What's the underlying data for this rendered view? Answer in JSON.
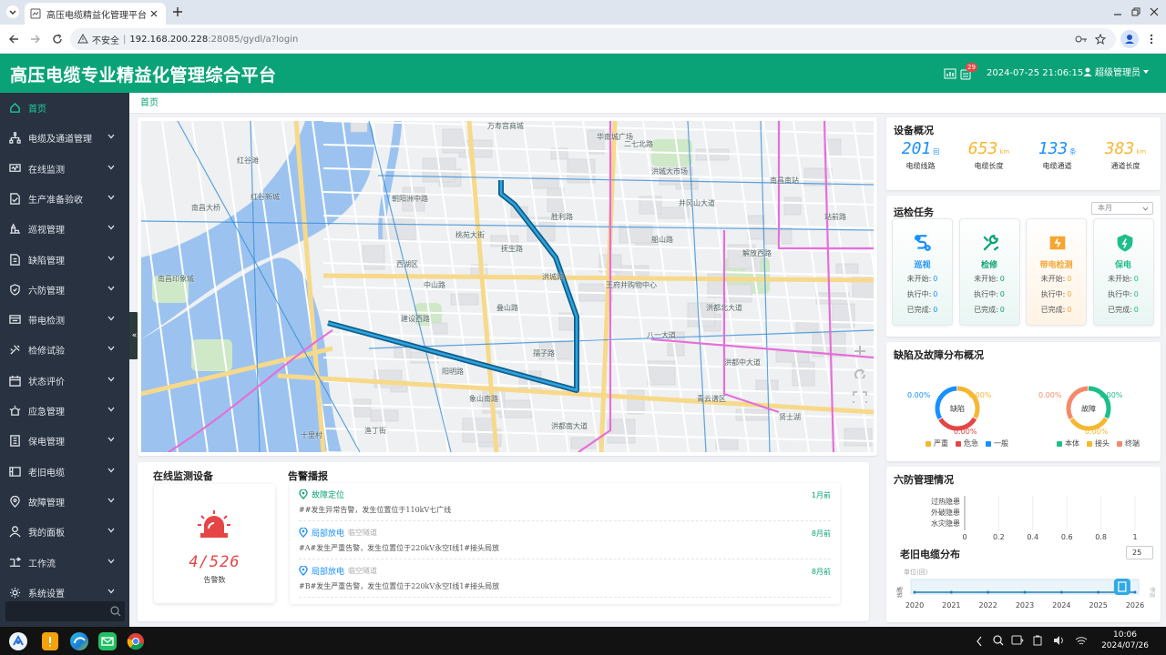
{
  "browser": {
    "tab_title": "高压电缆精益化管理平台",
    "insecure_label": "不安全",
    "url_host": "192.168.200.228",
    "url_rest": ":28085/gydl/a?login"
  },
  "header": {
    "title": "高压电缆专业精益化管理综合平台",
    "notification_count": "29",
    "datetime": "2024-07-25 21:06:15",
    "user": "超级管理员"
  },
  "sidebar": {
    "items": [
      {
        "label": "首页",
        "icon": "home-icon"
      },
      {
        "label": "电缆及通道管理",
        "icon": "hierarchy-icon"
      },
      {
        "label": "在线监测",
        "icon": "monitor-icon"
      },
      {
        "label": "生产准备验收",
        "icon": "document-check-icon"
      },
      {
        "label": "巡视管理",
        "icon": "patrol-icon"
      },
      {
        "label": "缺陷管理",
        "icon": "defect-icon"
      },
      {
        "label": "六防管理",
        "icon": "shield-icon"
      },
      {
        "label": "带电检测",
        "icon": "detect-icon"
      },
      {
        "label": "检修试验",
        "icon": "tools-icon"
      },
      {
        "label": "状态评价",
        "icon": "calendar-icon"
      },
      {
        "label": "应急管理",
        "icon": "emergency-icon"
      },
      {
        "label": "保电管理",
        "icon": "power-guard-icon"
      },
      {
        "label": "老旧电缆",
        "icon": "old-cable-icon"
      },
      {
        "label": "故障管理",
        "icon": "location-icon"
      },
      {
        "label": "我的面板",
        "icon": "user-icon"
      },
      {
        "label": "工作流",
        "icon": "workflow-icon"
      },
      {
        "label": "系统设置",
        "icon": "settings-icon"
      }
    ]
  },
  "breadcrumb": "首页",
  "map": {
    "labels": [
      "万寿宫商城",
      "华南城广场",
      "红谷滩",
      "南昌大桥",
      "红谷新城",
      "南昌印象城",
      "朝阳洲中路",
      "西湖区",
      "洪城路",
      "八一大道",
      "建设西路",
      "桃苑大街",
      "抚生路",
      "井冈山大道",
      "王府井购物中心",
      "洪都中大道",
      "渔丁街",
      "十里村",
      "贤士湖",
      "洪都北大道",
      "解放西路",
      "洪城大市场",
      "南昌南站",
      "二七北路",
      "青云谱区",
      "洪都南大道",
      "象山南路",
      "孺子路",
      "阳明路",
      "中山路",
      "叠山路",
      "船山路",
      "胜利路",
      "站前路"
    ],
    "brand_color": "#1d7fb4"
  },
  "overview": {
    "title": "设备概况",
    "stats": [
      {
        "value": "201",
        "unit": "回",
        "label": "电缆线路",
        "color": "#1890ff"
      },
      {
        "value": "653",
        "unit": "km",
        "label": "电缆长度",
        "color": "#f7b731"
      },
      {
        "value": "133",
        "unit": "条",
        "label": "电缆通道",
        "color": "#1890ff"
      },
      {
        "value": "383",
        "unit": "km",
        "label": "通道长度",
        "color": "#f7b731"
      }
    ]
  },
  "tasks": {
    "title": "运检任务",
    "period": "本月",
    "items": [
      {
        "name": "巡视",
        "color": "#1890ff",
        "not_started_label": "未开始:",
        "not_started": "0",
        "in_progress_label": "执行中:",
        "in_progress": "0",
        "done_label": "已完成:",
        "done": "0"
      },
      {
        "name": "检修",
        "color": "#0aa377",
        "not_started_label": "未开始:",
        "not_started": "0",
        "in_progress_label": "执行中:",
        "in_progress": "0",
        "done_label": "已完成:",
        "done": "0"
      },
      {
        "name": "带电检测",
        "color": "#f7a531",
        "not_started_label": "未开始:",
        "not_started": "0",
        "in_progress_label": "执行中:",
        "in_progress": "0",
        "done_label": "已完成:",
        "done": "0"
      },
      {
        "name": "保电",
        "color": "#1cbf8a",
        "not_started_label": "未开始:",
        "not_started": "0",
        "in_progress_label": "执行中:",
        "in_progress": "0",
        "done_label": "已完成:",
        "done": "0"
      }
    ]
  },
  "faults": {
    "title": "缺陷及故障分布概况",
    "donuts": [
      {
        "center": "缺陷",
        "pcts": [
          "0.00%",
          "0.00%",
          "0.00%"
        ],
        "legend": [
          "严重",
          "危急",
          "一般"
        ],
        "colors": [
          "#f7b731",
          "#e64545",
          "#1890ff"
        ]
      },
      {
        "center": "故障",
        "pcts": [
          "0.00%",
          "0.00%",
          "0.00%"
        ],
        "legend": [
          "本体",
          "接头",
          "终端"
        ],
        "colors": [
          "#1cbf8a",
          "#f7b731",
          "#f48a6b"
        ]
      }
    ]
  },
  "six_prevention": {
    "title": "六防管理情况",
    "categories": [
      "过热隐患",
      "外破隐患",
      "水灾隐患"
    ],
    "x_ticks": [
      "0",
      "0.2",
      "0.4",
      "0.6",
      "0.8",
      "1"
    ]
  },
  "old_cable": {
    "title": "老旧电缆分布",
    "input_value": "25",
    "unit_label": "单位(回)",
    "years": [
      "2020",
      "2021",
      "2022",
      "2023",
      "2024",
      "2025",
      "2026"
    ],
    "y_label": "线路",
    "side_label": "停运"
  },
  "monitoring": {
    "title": "在线监测设备",
    "count": "4/526",
    "count_label": "告警数"
  },
  "alarms": {
    "title": "告警播报",
    "items": [
      {
        "type": "故障定位",
        "tag": "",
        "time": "1月前",
        "desc": "##发生异常告警，发生位置位于110kV七广线",
        "color": "#0aa377"
      },
      {
        "type": "局部放电",
        "tag": "临空隧道",
        "time": "8月前",
        "desc": "#A#发生严重告警，发生位置位于220kV永空Ⅰ线1#接头局放",
        "color": "#1890ff"
      },
      {
        "type": "局部放电",
        "tag": "临空隧道",
        "time": "8月前",
        "desc": "#B#发生严重告警，发生位置位于220kV永空Ⅰ线1#接头局放",
        "color": "#1890ff"
      }
    ]
  },
  "taskbar": {
    "time": "10:06",
    "date": "2024/07/26"
  }
}
